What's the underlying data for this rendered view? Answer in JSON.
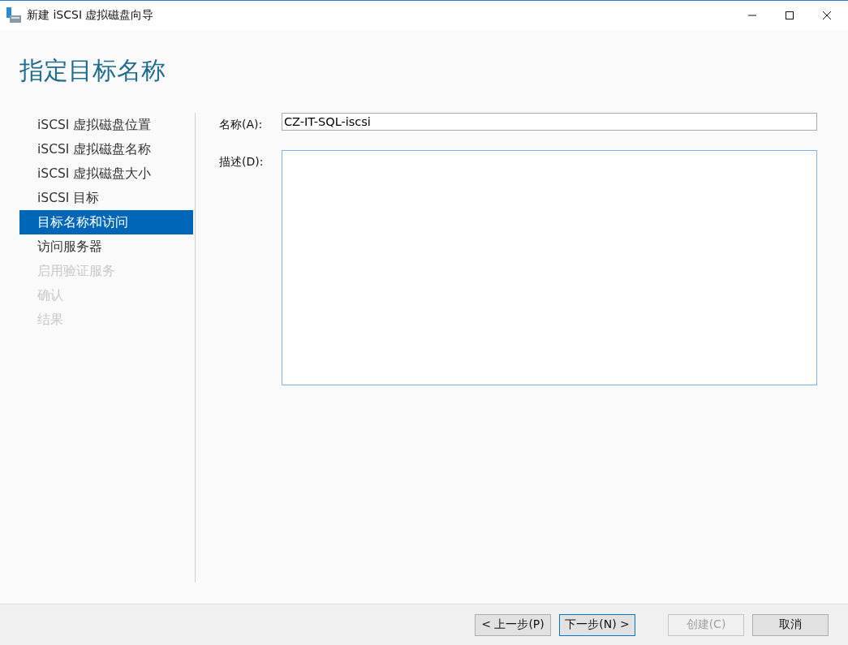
{
  "window": {
    "title": "新建 iSCSI 虚拟磁盘向导"
  },
  "heading": "指定目标名称",
  "steps": [
    {
      "label": "iSCSI 虚拟磁盘位置",
      "selected": false,
      "disabled": false
    },
    {
      "label": "iSCSI 虚拟磁盘名称",
      "selected": false,
      "disabled": false
    },
    {
      "label": "iSCSI 虚拟磁盘大小",
      "selected": false,
      "disabled": false
    },
    {
      "label": "iSCSI 目标",
      "selected": false,
      "disabled": false
    },
    {
      "label": "目标名称和访问",
      "selected": true,
      "disabled": false
    },
    {
      "label": "访问服务器",
      "selected": false,
      "disabled": false
    },
    {
      "label": "启用验证服务",
      "selected": false,
      "disabled": true
    },
    {
      "label": "确认",
      "selected": false,
      "disabled": true
    },
    {
      "label": "结果",
      "selected": false,
      "disabled": true
    }
  ],
  "form": {
    "name_label": "名称(A):",
    "name_value": "CZ-IT-SQL-iscsi",
    "description_label": "描述(D):"
  },
  "buttons": [
    {
      "label": "< 上一步(P)",
      "disabled": false,
      "focused": false
    },
    {
      "label": "下一步(N) >",
      "disabled": false,
      "focused": true
    },
    {
      "label": "创建(C)",
      "disabled": true,
      "focused": false
    },
    {
      "label": "取消",
      "disabled": false,
      "focused": false
    }
  ]
}
